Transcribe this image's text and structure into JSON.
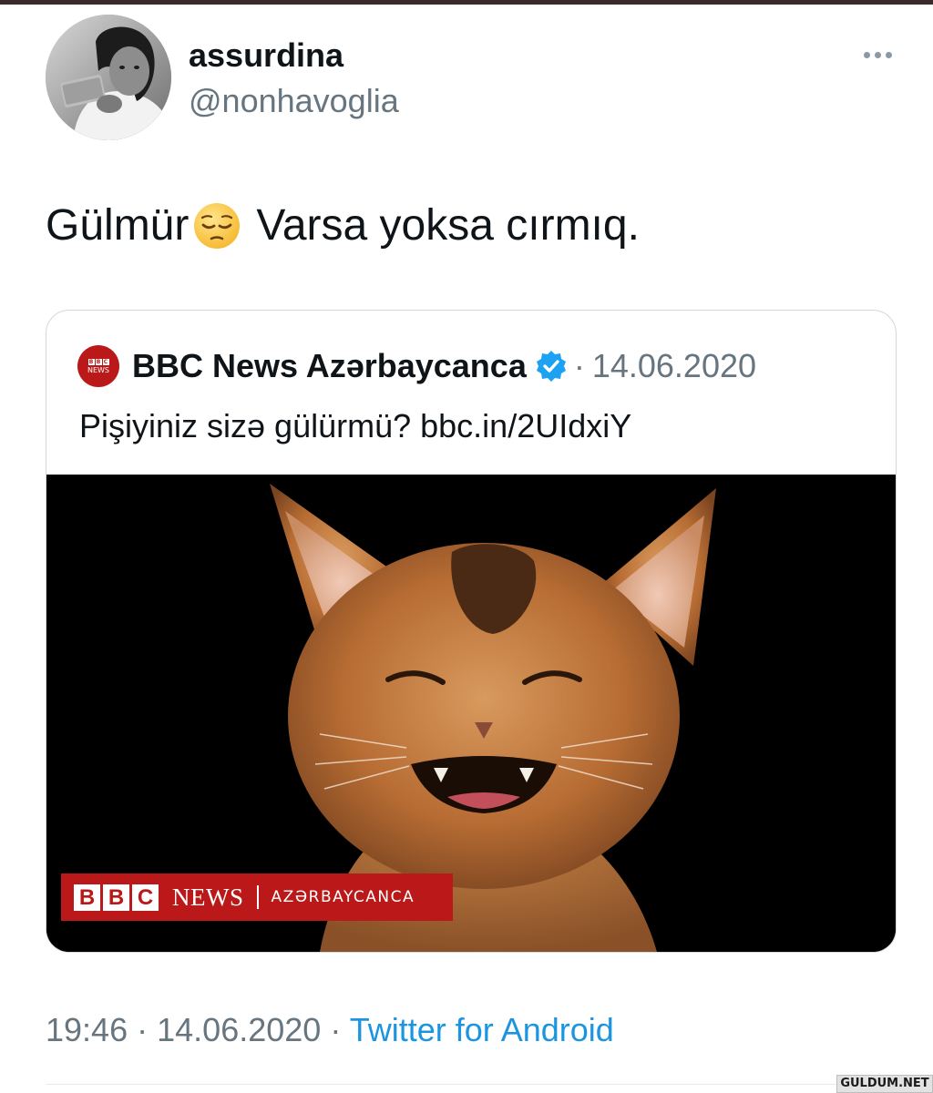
{
  "tweet": {
    "author": {
      "display_name": "assurdina",
      "handle": "@nonhavoglia",
      "avatar": "profile-photo"
    },
    "more_icon": "more-horizontal-icon",
    "text_before_emoji": "Gülmür",
    "emoji": "pensive-face-emoji",
    "text_after_emoji": "Varsa yoksa cırmıq.",
    "time": "19:46",
    "date": "14.06.2020",
    "separator": "·",
    "source": "Twitter for Android"
  },
  "quoted_tweet": {
    "author_name": "BBC News Azərbaycanca",
    "verified_icon": "verified-badge-icon",
    "separator": "·",
    "date": "14.06.2020",
    "avatar_logo_blocks": [
      "B",
      "B",
      "C"
    ],
    "avatar_logo_news": "NEWS",
    "text": "Pişiyiniz sizə gülürmü? bbc.in/2UIdxiY",
    "image": {
      "description_icon": "smiling-kitten-photo",
      "banner": {
        "blocks": [
          "B",
          "B",
          "C"
        ],
        "news": "NEWS",
        "divider": "|",
        "sub": "AZƏRBAYCANCA"
      }
    }
  },
  "watermark": "GULDUM.NET",
  "colors": {
    "text": "#0f1419",
    "muted": "#66757f",
    "link": "#1b95e0",
    "border": "#cfd9de",
    "bbc_red": "#bb1919",
    "verified": "#1da1f2"
  }
}
